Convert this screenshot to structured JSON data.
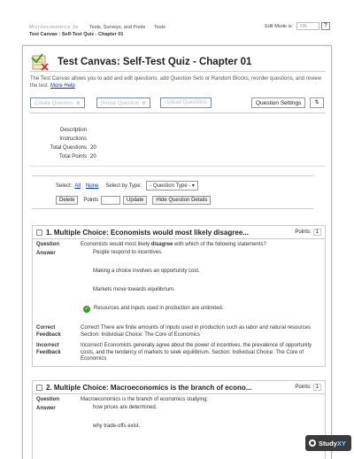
{
  "topbar": {
    "course": "Microeconomics 3e",
    "crumb_tests": "Tests, Surveys, and Pools",
    "crumb_tests2": "Tests",
    "edit_mode_label": "Edit Mode is:",
    "edit_mode_value": "ON",
    "help": "?"
  },
  "breadcrumb": "Test Canvas : Self-Test Quiz - Chapter 01",
  "header": {
    "title": "Test Canvas: Self-Test Quiz - Chapter 01",
    "description": "The Test Canvas allows you to add and edit questions, add Question Sets or Random Blocks, reorder questions, and review the test.",
    "more_help": "More Help"
  },
  "toolbar": {
    "create_question": "Create Question",
    "reuse_question": "Reuse Question",
    "upload_questions": "Upload Questions",
    "question_settings": "Question Settings",
    "sort_icon": "⇅"
  },
  "properties": {
    "description_label": "Description",
    "instructions_label": "Instructions",
    "total_questions_label": "Total Questions",
    "total_questions_value": "20",
    "total_points_label": "Total Points",
    "total_points_value": "20"
  },
  "filter": {
    "select_label": "Select:",
    "all": "All",
    "none": "None",
    "select_by_type": "Select by Type:",
    "type_dropdown": "- Question Type -",
    "delete": "Delete",
    "points": "Points",
    "update": "Update",
    "hide_details": "Hide Question Details"
  },
  "questions": [
    {
      "title": "1. Multiple Choice: Economists would most likely disagree...",
      "points_label": "Points:",
      "points_value": "1",
      "question_label": "Question",
      "question_pre": "Economists would most likely ",
      "question_bold": "disagree",
      "question_post": " with which of the following statements?",
      "answer_label": "Answer",
      "answers": [
        "People respond to incentives.",
        "Making a choice involves an opportunity cost.",
        "Markets move towards equilibrium.",
        "Resources and inputs used in production are unlimited."
      ],
      "correct_feedback_label": "Correct Feedback",
      "correct_feedback": "Correct! There are finite amounts of inputs used in production such as labor and natural resources Section: Individual Choice: The Core of Economics",
      "incorrect_feedback_label": "Incorrect Feedback",
      "incorrect_feedback": "Incorrect! Economists generally agree about the power of incentives, the prevalence of opportunity costs, and the tendency of markets to seek equilibrium. Section: Individual Choice: The Core of Economics"
    },
    {
      "title": "2. Multiple Choice: Macroeconomics is the branch of econo...",
      "points_label": "Points:",
      "points_value": "1",
      "question_label": "Question",
      "question_text": "Macroeconomics is the branch of economics studying:",
      "answer_label": "Answer",
      "answers": [
        "how prices are determined.",
        "why trade-offs exist."
      ]
    }
  ],
  "badge": {
    "study": "Study",
    "xy": "XY"
  },
  "colors": {
    "link": "#0033cc",
    "correct_check": "#3b9a2f",
    "toolbar_border": "#7a8bb5"
  }
}
